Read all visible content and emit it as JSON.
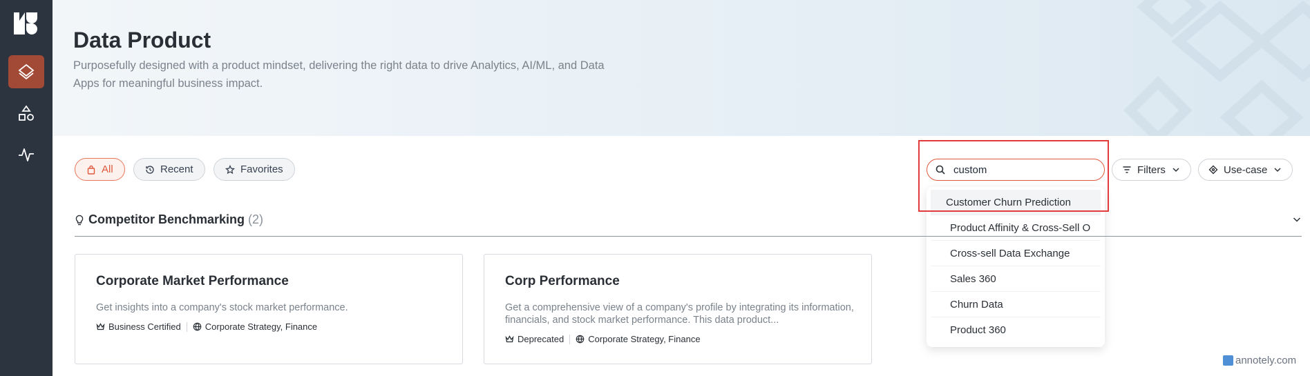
{
  "header": {
    "title": "Data Product",
    "description": "Purposefully designed with a product mindset, delivering the right data to drive Analytics, AI/ML, and Data Apps for meaningful business impact."
  },
  "filters": {
    "chips": [
      {
        "label": "All",
        "icon": "bag-icon",
        "active": true
      },
      {
        "label": "Recent",
        "icon": "history-icon",
        "active": false
      },
      {
        "label": "Favorites",
        "icon": "star-icon",
        "active": false
      }
    ]
  },
  "search": {
    "value": "custom",
    "suggestions": [
      "Customer Churn Prediction",
      "Product Affinity & Cross-Sell O",
      "Cross-sell Data Exchange",
      "Sales 360",
      "Churn Data",
      "Product 360"
    ]
  },
  "toolbar": {
    "filters_label": "Filters",
    "usecase_label": "Use-case"
  },
  "section": {
    "title": "Competitor Benchmarking",
    "count": "(2)"
  },
  "cards": [
    {
      "title": "Corporate Market Performance",
      "description": "Get insights into a company's stock market performance.",
      "status": "Business Certified",
      "domain": "Corporate Strategy, Finance"
    },
    {
      "title": "Corp Performance",
      "description": "Get a comprehensive view of a company's profile by integrating its information, financials, and stock market performance. This data product...",
      "status": "Deprecated",
      "domain": "Corporate Strategy, Finance"
    }
  ],
  "watermark": "annotely.com",
  "colors": {
    "sidebar": "#2c3440",
    "sidebar_active": "#a34a37",
    "accent": "#e0583c",
    "highlight": "#e23b3b"
  }
}
